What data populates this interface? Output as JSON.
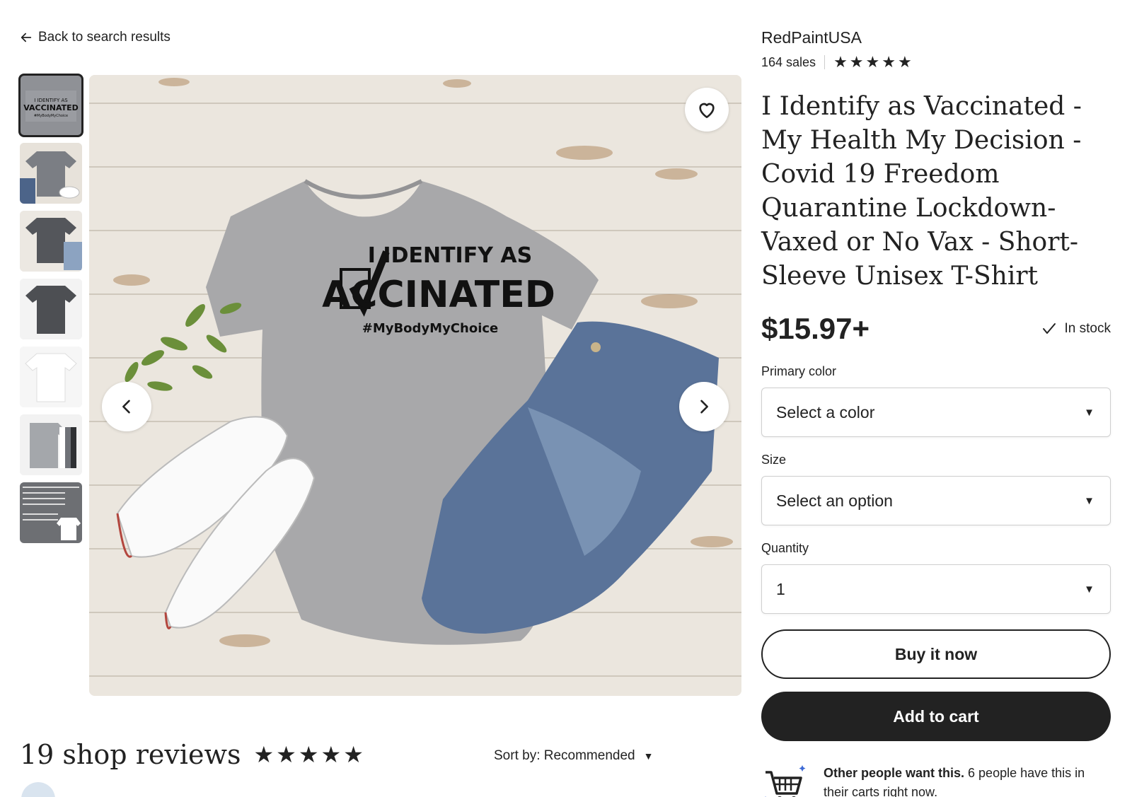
{
  "nav": {
    "back_label": "Back to search results"
  },
  "gallery": {
    "thumbnails": [
      {
        "name": "thumb-1",
        "active": true
      },
      {
        "name": "thumb-2",
        "active": false
      },
      {
        "name": "thumb-3",
        "active": false
      },
      {
        "name": "thumb-4",
        "active": false
      },
      {
        "name": "thumb-5",
        "active": false
      },
      {
        "name": "thumb-6",
        "active": false
      },
      {
        "name": "thumb-7",
        "active": false
      }
    ],
    "shirt_text": {
      "line1": "I IDENTIFY AS",
      "line2": "ACCINATED",
      "line3": "#MyBodyMyChoice"
    },
    "icons": {
      "favorite": "heart-icon",
      "prev": "chevron-left-icon",
      "next": "chevron-right-icon"
    }
  },
  "shop": {
    "name": "RedPaintUSA",
    "sales": "164 sales",
    "rating_stars": 5
  },
  "listing": {
    "title": "I Identify as Vaccinated - My Health My Decision - Covid 19 Freedom Quarantine Lockdown- Vaxed or No Vax - Short-Sleeve Unisex T-Shirt",
    "price": "$15.97+",
    "stock": "In stock"
  },
  "options": {
    "color_label": "Primary color",
    "color_value": "Select a color",
    "size_label": "Size",
    "size_value": "Select an option",
    "quantity_label": "Quantity",
    "quantity_value": "1"
  },
  "actions": {
    "buy_now": "Buy it now",
    "add_to_cart": "Add to cart"
  },
  "demand": {
    "bold": "Other people want this.",
    "rest": " 6 people have this in their carts right now."
  },
  "reviews": {
    "title": "19 shop reviews",
    "rating_stars": 5,
    "sort_label": "Sort by: Recommended"
  },
  "colors": {
    "text": "#222222",
    "button_dark": "#222222",
    "border": "#cfcfcf"
  }
}
